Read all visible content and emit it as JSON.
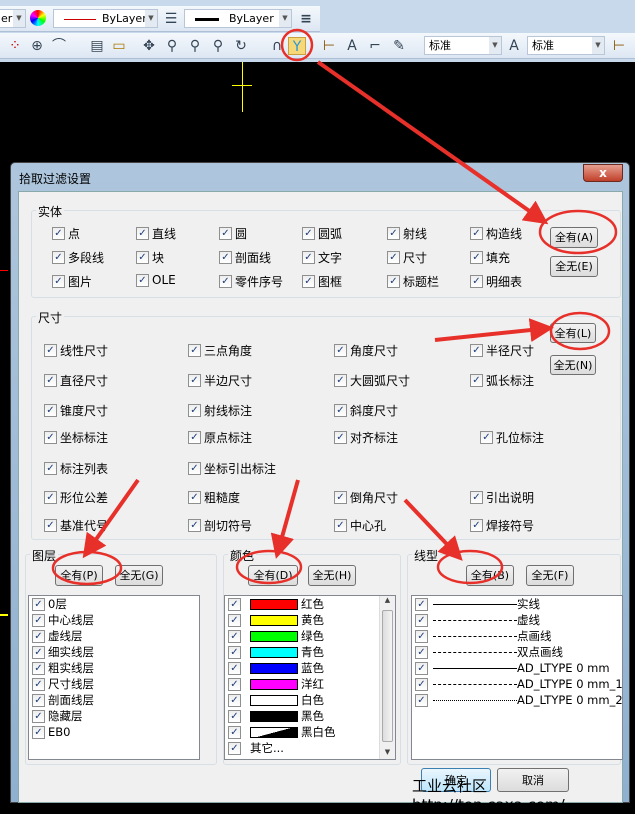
{
  "toolbar": {
    "layer_combo": "er",
    "color_combo": "ByLayer",
    "linewidth_combo": "ByLayer",
    "text_style_combo": "标准",
    "dim_style_combo": "标准",
    "icons": [
      "layer-icon",
      "color-wheel-icon",
      "linetype-icon",
      "lineweight-icon",
      "grid-icon",
      "snap-icon",
      "arc-icon",
      "property-icon",
      "measure-icon",
      "pan-icon",
      "zoom-icon",
      "zoom-window-icon",
      "zoom-previous-icon",
      "zoom-rotate-icon",
      "magnet-icon",
      "pick-filter-icon",
      "dim-style-icon",
      "text-style-icon",
      "table-style-icon",
      "notes-icon"
    ]
  },
  "dialog": {
    "title": "拾取过滤设置",
    "close_label": "x",
    "entity": {
      "title": "实体",
      "items": [
        "点",
        "直线",
        "圆",
        "圆弧",
        "射线",
        "构造线",
        "多段线",
        "块",
        "剖面线",
        "文字",
        "尺寸",
        "填充",
        "图片",
        "OLE",
        "零件序号",
        "图框",
        "标题栏",
        "明细表"
      ],
      "all_label": "全有(A)",
      "none_label": "全无(E)"
    },
    "dimension": {
      "title": "尺寸",
      "items": [
        "线性尺寸",
        "三点角度",
        "角度尺寸",
        "半径尺寸",
        "直径尺寸",
        "半边尺寸",
        "大圆弧尺寸",
        "弧长标注",
        "锥度尺寸",
        "射线标注",
        "斜度尺寸",
        "坐标标注",
        "原点标注",
        "对齐标注",
        "孔位标注",
        "标注列表",
        "坐标引出标注",
        "形位公差",
        "粗糙度",
        "倒角尺寸",
        "引出说明",
        "基准代号",
        "剖切符号",
        "中心孔",
        "焊接符号"
      ],
      "all_label": "全有(L)",
      "none_label": "全无(N)"
    },
    "layer": {
      "title": "图层",
      "all_label": "全有(P)",
      "none_label": "全无(G)",
      "items": [
        "0层",
        "中心线层",
        "虚线层",
        "细实线层",
        "粗实线层",
        "尺寸线层",
        "剖面线层",
        "隐藏层",
        "EB0"
      ]
    },
    "color": {
      "title": "颜色",
      "all_label": "全有(D)",
      "none_label": "全无(H)",
      "items": [
        {
          "label": "红色",
          "hex": "#ff0000"
        },
        {
          "label": "黄色",
          "hex": "#ffff00"
        },
        {
          "label": "绿色",
          "hex": "#00ff00"
        },
        {
          "label": "青色",
          "hex": "#00ffff"
        },
        {
          "label": "蓝色",
          "hex": "#0000ff"
        },
        {
          "label": "洋红",
          "hex": "#ff00ff"
        },
        {
          "label": "白色",
          "hex": "#ffffff"
        },
        {
          "label": "黑色",
          "hex": "#000000"
        },
        {
          "label": "黑白色",
          "hex": "split"
        },
        {
          "label": "其它...",
          "hex": ""
        }
      ]
    },
    "linetype": {
      "title": "线型",
      "all_label": "全有(B)",
      "none_label": "全无(F)",
      "items": [
        {
          "label": "实线",
          "style": "solid"
        },
        {
          "label": "虚线",
          "style": "dashed"
        },
        {
          "label": "点画线",
          "style": "dashdot"
        },
        {
          "label": "双点画线",
          "style": "dashdotdot"
        },
        {
          "label": "AD_LTYPE 0 mm",
          "style": "solid"
        },
        {
          "label": "AD_LTYPE 0 mm_1",
          "style": "dashdot"
        },
        {
          "label": "AD_LTYPE 0 mm_2",
          "style": "dotted"
        }
      ]
    },
    "ok_label": "确定",
    "cancel_label": "取消"
  },
  "watermark": "工业云社区 http://top.caxa.com/",
  "colors": {
    "annotation": "#e8302a",
    "canvas": "#000000"
  }
}
